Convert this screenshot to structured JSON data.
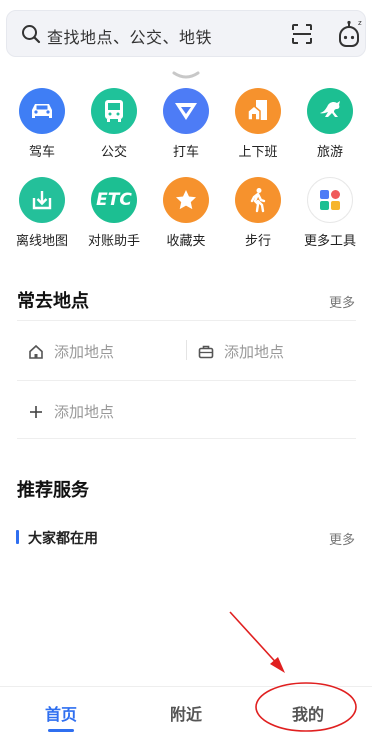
{
  "search": {
    "placeholder": "查找地点、公交、地铁"
  },
  "grid": [
    {
      "label": "驾车",
      "color": "#3f7ef5",
      "icon": "car-icon"
    },
    {
      "label": "公交",
      "color": "#1fc29a",
      "icon": "bus-icon"
    },
    {
      "label": "打车",
      "color": "#4d7cf6",
      "icon": "taxi-icon"
    },
    {
      "label": "上下班",
      "color": "#f6922d",
      "icon": "commute-icon"
    },
    {
      "label": "旅游",
      "color": "#1cbf92",
      "icon": "horse-icon"
    },
    {
      "label": "离线地图",
      "color": "#24c09a",
      "icon": "download-icon"
    },
    {
      "label": "对账助手",
      "color": "#1cbf92",
      "icon": "etc-icon",
      "text": "ETC"
    },
    {
      "label": "收藏夹",
      "color": "#f6922d",
      "icon": "star-icon"
    },
    {
      "label": "步行",
      "color": "#f6922d",
      "icon": "walk-icon"
    },
    {
      "label": "更多工具",
      "color": "#ffffff",
      "icon": "apps-icon"
    }
  ],
  "frequent": {
    "title": "常去地点",
    "more": "更多",
    "home": "添加地点",
    "work": "添加地点",
    "add": "添加地点"
  },
  "recommend": {
    "title": "推荐服务",
    "sub": "大家都在用",
    "more": "更多"
  },
  "tabs": [
    {
      "label": "首页",
      "active": true
    },
    {
      "label": "附近",
      "active": false
    },
    {
      "label": "我的",
      "active": false
    }
  ]
}
